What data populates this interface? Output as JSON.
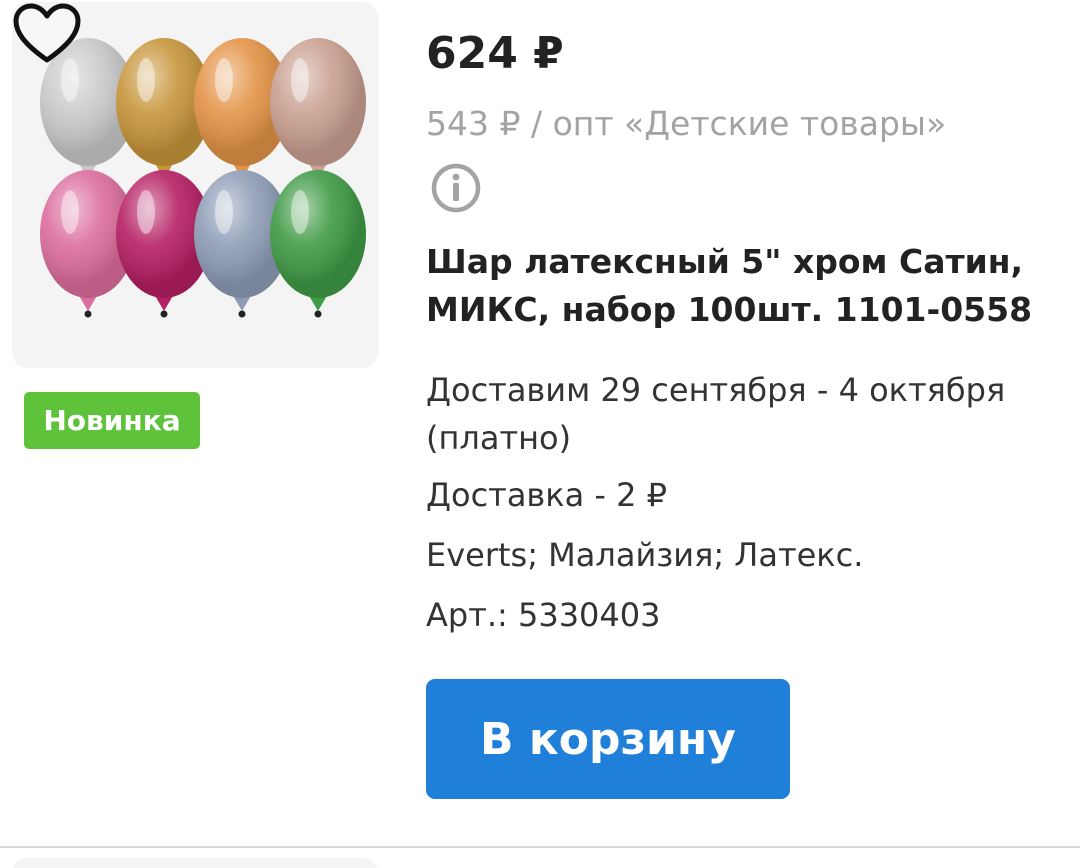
{
  "product": {
    "price": "624 ₽",
    "wholesale_price": "543 ₽ / опт «Детские товары»",
    "title": "Шар латексный 5\" хром Сатин, МИКС, набор 100шт. 1101-0558",
    "badge": "Новинка",
    "delivery_date": "Доставим 29 сентября - 4 октября (платно)",
    "delivery_cost": "Доставка - 2 ₽",
    "brand_info": "Everts; Малайзия; Латекс.",
    "sku": "Арт.: 5330403",
    "add_to_cart_label": "В корзину"
  },
  "icons": {
    "favorite": "heart-icon",
    "info": "info-icon"
  },
  "colors": {
    "badge_bg": "#5ec33a",
    "button_bg": "#1f7fd9",
    "muted_text": "#a3a3a3"
  },
  "balloon_colors": [
    "#c9c9c9",
    "#c7953a",
    "#e39346",
    "#c9a091",
    "#dc6d9c",
    "#b51f63",
    "#8e9cb6",
    "#3f9a45"
  ]
}
